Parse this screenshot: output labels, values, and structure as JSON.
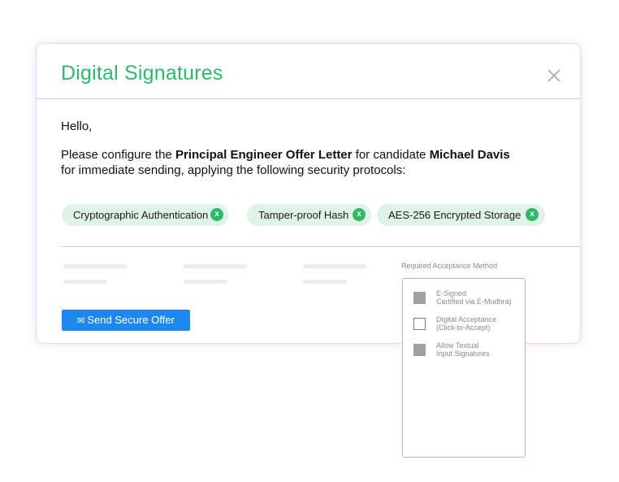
{
  "modal": {
    "title": "Digital Signatures",
    "close_icon": "close-icon"
  },
  "body": {
    "greeting": "Hello,",
    "message_part1": "Please configure the ",
    "document_name": "Principal Engineer Offer Letter",
    "message_part2": " for candidate ",
    "candidate_name": "Michael Davis",
    "message_part3": "for immediate sending, applying the following security protocols:"
  },
  "protocols": [
    {
      "label": "Cryptographic Authentication",
      "remove": "x"
    },
    {
      "label": "Tamper-proof Hash",
      "remove": "x"
    },
    {
      "label": "AES-256 Encrypted Storage",
      "remove": "x"
    }
  ],
  "send_button": {
    "icon": "envelope-icon",
    "label": "Send Secure Offer"
  },
  "acceptance": {
    "label": "Required Acceptance Method",
    "options": [
      {
        "line1": "E-Signed",
        "line2": "Certified via E-Mudhra)",
        "checked": true
      },
      {
        "line1": "Digital Acceptance",
        "line2": "(Click-to-Accept)",
        "checked": false
      },
      {
        "line1": "Allow Textual",
        "line2": "Input Signatures",
        "checked": true
      }
    ]
  },
  "colors": {
    "accent_green": "#2fb86a",
    "chip_background": "#dff3e6",
    "button_blue": "#1e88f0",
    "modal_border": "#ead7f2",
    "dropdown_border": "#c9a6d6"
  }
}
